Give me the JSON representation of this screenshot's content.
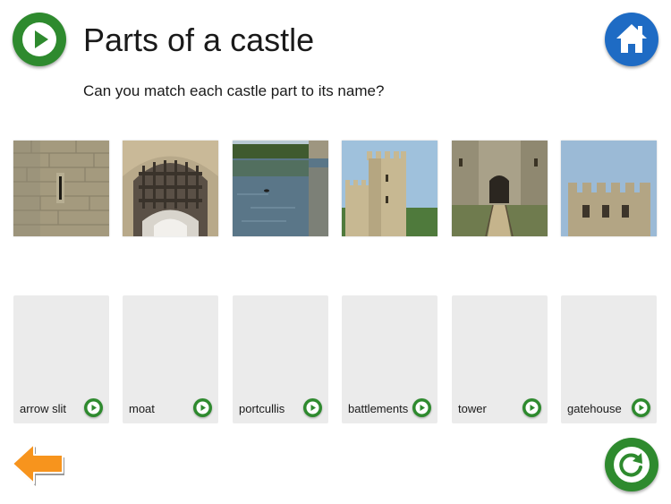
{
  "header": {
    "title": "Parts of a castle",
    "instruction": "Can you match each castle part to its name?"
  },
  "buttons": {
    "play_icon": "play-icon",
    "home_icon": "home-icon",
    "back_icon": "arrow-left-icon",
    "reset_icon": "refresh-icon"
  },
  "photos": [
    {
      "subject": "arrow slit"
    },
    {
      "subject": "portcullis"
    },
    {
      "subject": "moat"
    },
    {
      "subject": "tower"
    },
    {
      "subject": "gatehouse"
    },
    {
      "subject": "battlements"
    }
  ],
  "cards": [
    {
      "label": "arrow slit"
    },
    {
      "label": "moat"
    },
    {
      "label": "portcullis"
    },
    {
      "label": "battlements"
    },
    {
      "label": "tower"
    },
    {
      "label": "gatehouse"
    }
  ],
  "colors": {
    "green": "#2e8a2e",
    "blue": "#1e6bc4",
    "orange": "#f7941d",
    "card_bg": "#ebebeb"
  }
}
